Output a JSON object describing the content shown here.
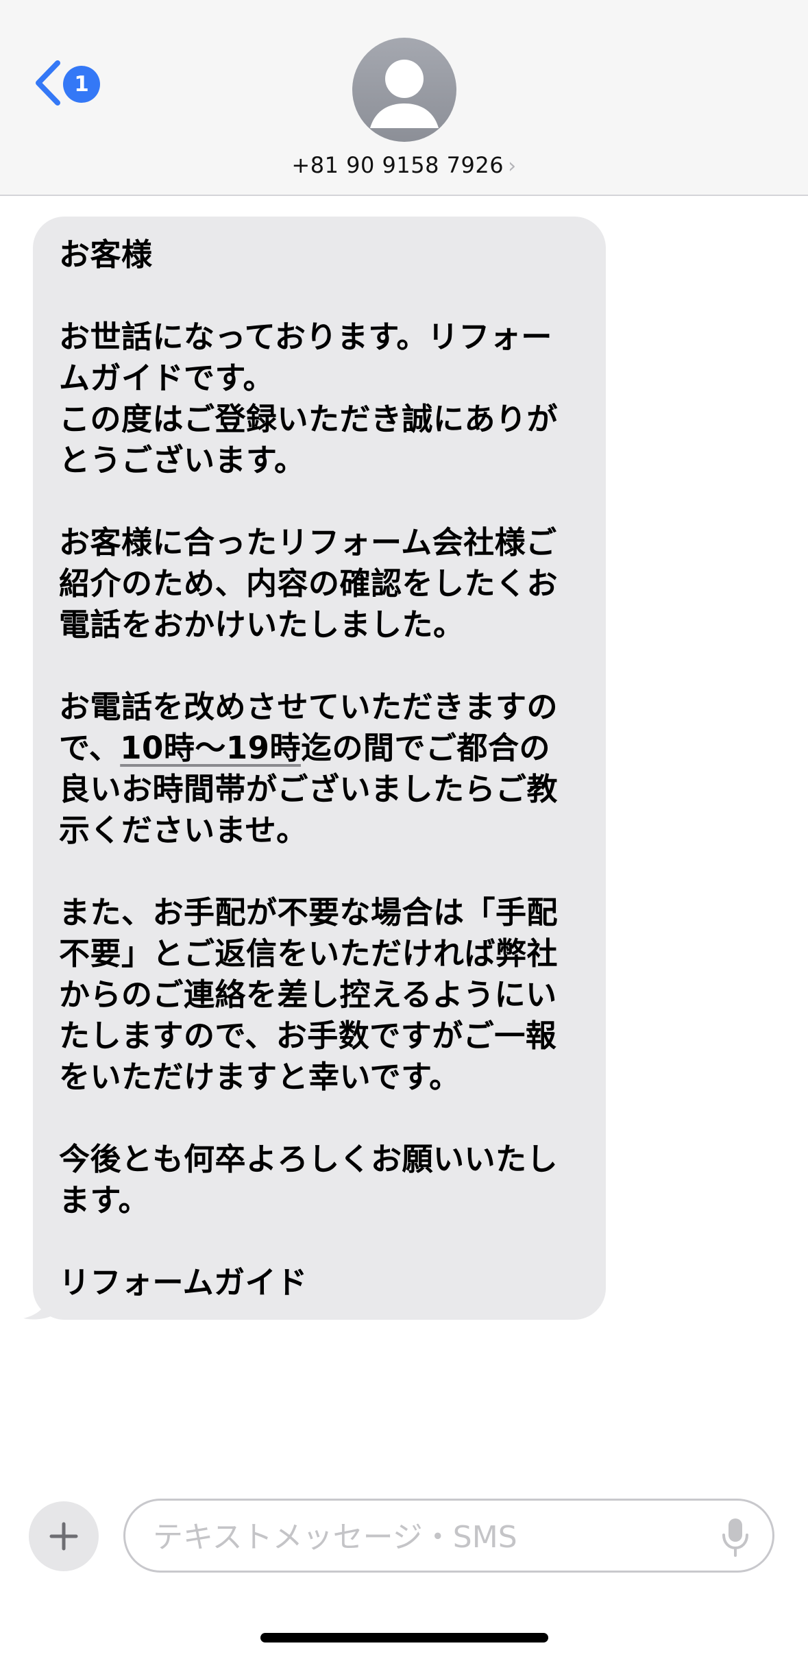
{
  "header": {
    "back_badge": "1",
    "contact_number": "+81 90 9158 7926",
    "contact_chevron": "›"
  },
  "message": {
    "paragraphs": [
      "お客様",
      "お世話になっております。リフォームガイドです。\nこの度はご登録いただき誠にありがとうございます。",
      "お客様に合ったリフォーム会社様ご紹介のため、内容の確認をしたくお電話をおかけいたしました。",
      {
        "before": "お電話を改めさせていただきますので、",
        "link": "10時〜19時",
        "after": "迄の間でご都合の良いお時間帯がございましたらご教示くださいませ。"
      },
      "また、お手配が不要な場合は「手配不要」とご返信をいただければ弊社からのご連絡を差し控えるようにいたしますので、お手数ですがご一報をいただけますと幸いです。",
      "今後とも何卒よろしくお願いいたします。",
      "リフォームガイド"
    ]
  },
  "composer": {
    "placeholder": "テキストメッセージ・SMS"
  },
  "icons": {
    "back": "chevron-left-icon",
    "avatar": "person-icon",
    "plus": "plus-icon",
    "mic": "microphone-icon"
  },
  "colors": {
    "accent": "#3478f6",
    "bubble": "#e9e9eb"
  }
}
